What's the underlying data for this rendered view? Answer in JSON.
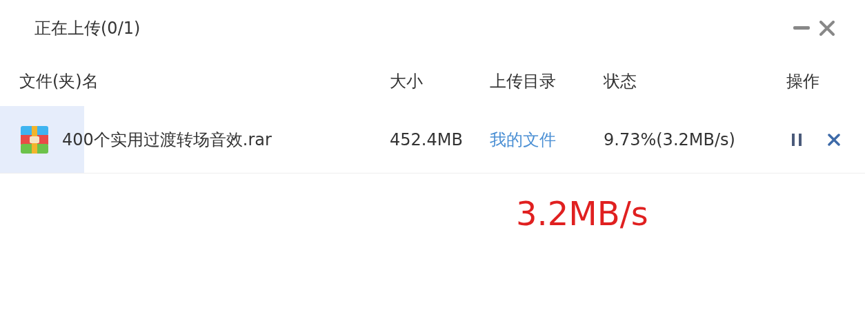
{
  "window": {
    "title": "正在上传(0/1)"
  },
  "columns": [
    "文件(夹)名",
    "大小",
    "上传目录",
    "状态",
    "操作"
  ],
  "rows": [
    {
      "name": "400个实用过渡转场音效.rar",
      "size": "452.4MB",
      "folder": "我的文件",
      "status": "9.73%(3.2MB/s)",
      "level": 0.0973
    }
  ],
  "annotation": "3.2MB/s"
}
